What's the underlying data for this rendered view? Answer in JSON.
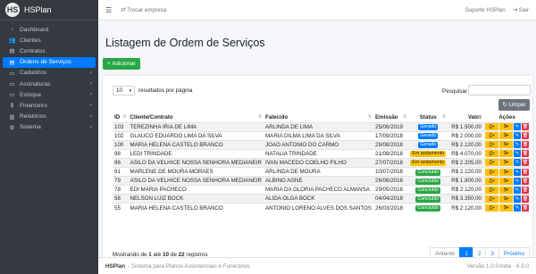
{
  "brand": {
    "logo": "HS",
    "name": "HSPlan"
  },
  "sidebar": {
    "items": [
      {
        "icon": "◔",
        "label": "Dashboard",
        "chevron": ""
      },
      {
        "icon": "👥",
        "label": "Clientes",
        "chevron": ""
      },
      {
        "icon": "▤",
        "label": "Contratos",
        "chevron": ""
      },
      {
        "icon": "▤",
        "label": "Ordens de Serviços",
        "chevron": ""
      },
      {
        "icon": "▭",
        "label": "Cadastros",
        "chevron": "‹"
      },
      {
        "icon": "▭",
        "label": "Assinaturas",
        "chevron": "‹"
      },
      {
        "icon": "▭",
        "label": "Estoque",
        "chevron": "‹"
      },
      {
        "icon": "$",
        "label": "Financeiro",
        "chevron": "‹"
      },
      {
        "icon": "▥",
        "label": "Relatórios",
        "chevron": "‹"
      },
      {
        "icon": "⚙",
        "label": "Sistema",
        "chevron": "‹"
      }
    ]
  },
  "topbar": {
    "switch_company": "⇄ Trocar empresa",
    "support": "Suporte HSPlan",
    "logout": "⇥ Sair"
  },
  "page": {
    "title": "Listagem de Ordem de Serviços",
    "add_label": "+ Adicionar"
  },
  "table_controls": {
    "page_length": "10",
    "length_suffix": "resultados por página",
    "search_label": "Pesquisar",
    "clear_label": "↻ Limpar"
  },
  "columns": [
    "ID",
    "Cliente/Contrato",
    "Falecido",
    "Emissão",
    "Status",
    "Valor",
    "Ações"
  ],
  "rows": [
    {
      "id": "103",
      "cliente": "TEREZINHA IRIA DE LIMA",
      "falecido": "ARLINDA DE LIMA",
      "emissao": "25/06/2019",
      "status": "Gerado",
      "valor": "R$ 1.500,00"
    },
    {
      "id": "102",
      "cliente": "GLAUCO EDUARDO LIMA DA SILVA",
      "falecido": "MARIA DILMA LIMA DA SILVA",
      "emissao": "17/09/2018",
      "status": "Gerado",
      "valor": "R$ 2.000,00"
    },
    {
      "id": "100",
      "cliente": "MARIA HELENA CASTELO BRANCO",
      "falecido": "JOAO ANTONIO DO CARMO",
      "emissao": "29/08/2018",
      "status": "Gerado",
      "valor": "R$ 2.120,00"
    },
    {
      "id": "98",
      "cliente": "LEDI TRINDADE",
      "falecido": "NATALIA TRINDADE",
      "emissao": "21/08/2018",
      "status": "Em andamento",
      "valor": "R$ 4.070,00"
    },
    {
      "id": "96",
      "cliente": "ASILO DA VELHICE NOSSA SENHORA MEDIANEIR",
      "falecido": "IVAN MACEDO COELHO FILHO",
      "emissao": "27/07/2018",
      "status": "Em andamento",
      "valor": "R$ 2.205,00"
    },
    {
      "id": "91",
      "cliente": "MARLENE DE MOURA MORAES",
      "falecido": "ARLINDA DE MOURA",
      "emissao": "10/07/2018",
      "status": "Concluído",
      "valor": "R$ 2.120,00"
    },
    {
      "id": "79",
      "cliente": "ASILO DA VELHICE NOSSA SENHORA MEDIANEIR",
      "falecido": "ALBINO AGNE",
      "emissao": "26/06/2018",
      "status": "Concluído",
      "valor": "R$ 1.800,00"
    },
    {
      "id": "78",
      "cliente": "EDI MARIA PACHECO",
      "falecido": "MARIA DA GLORIA PACHECO ALMANSA",
      "emissao": "29/05/2018",
      "status": "Concluído",
      "valor": "R$ 2.120,00"
    },
    {
      "id": "56",
      "cliente": "NELSON LUIZ BOCK",
      "falecido": "ALIDA OLGA BOCK",
      "emissao": "04/04/2018",
      "status": "Concluído",
      "valor": "R$ 3.350,00"
    },
    {
      "id": "55",
      "cliente": "MARIA HELENA CASTELO BRANCO",
      "falecido": "ANTONIO LORENO ALVES DOS SANTOS",
      "emissao": "26/03/2018",
      "status": "Concluído",
      "valor": "R$ 2.120,00"
    }
  ],
  "info": {
    "prefix": "Mostrando de",
    "from": "1",
    "mid1": "até",
    "to": "10",
    "mid2": "de",
    "total": "22",
    "suffix": "registros"
  },
  "pagination": [
    "Anterior",
    "1",
    "2",
    "3",
    "Próximo"
  ],
  "footer": {
    "brand": "HSPlan",
    "tagline": "- Sistema para Planos Assistenciais e Funerários",
    "version": "Versão 1.0.0-beta - 6.9.0"
  },
  "colors": {
    "sidebar": "#343a40",
    "primary": "#007bff",
    "success": "#28a745",
    "warning": "#ffc107",
    "danger": "#dc3545"
  }
}
